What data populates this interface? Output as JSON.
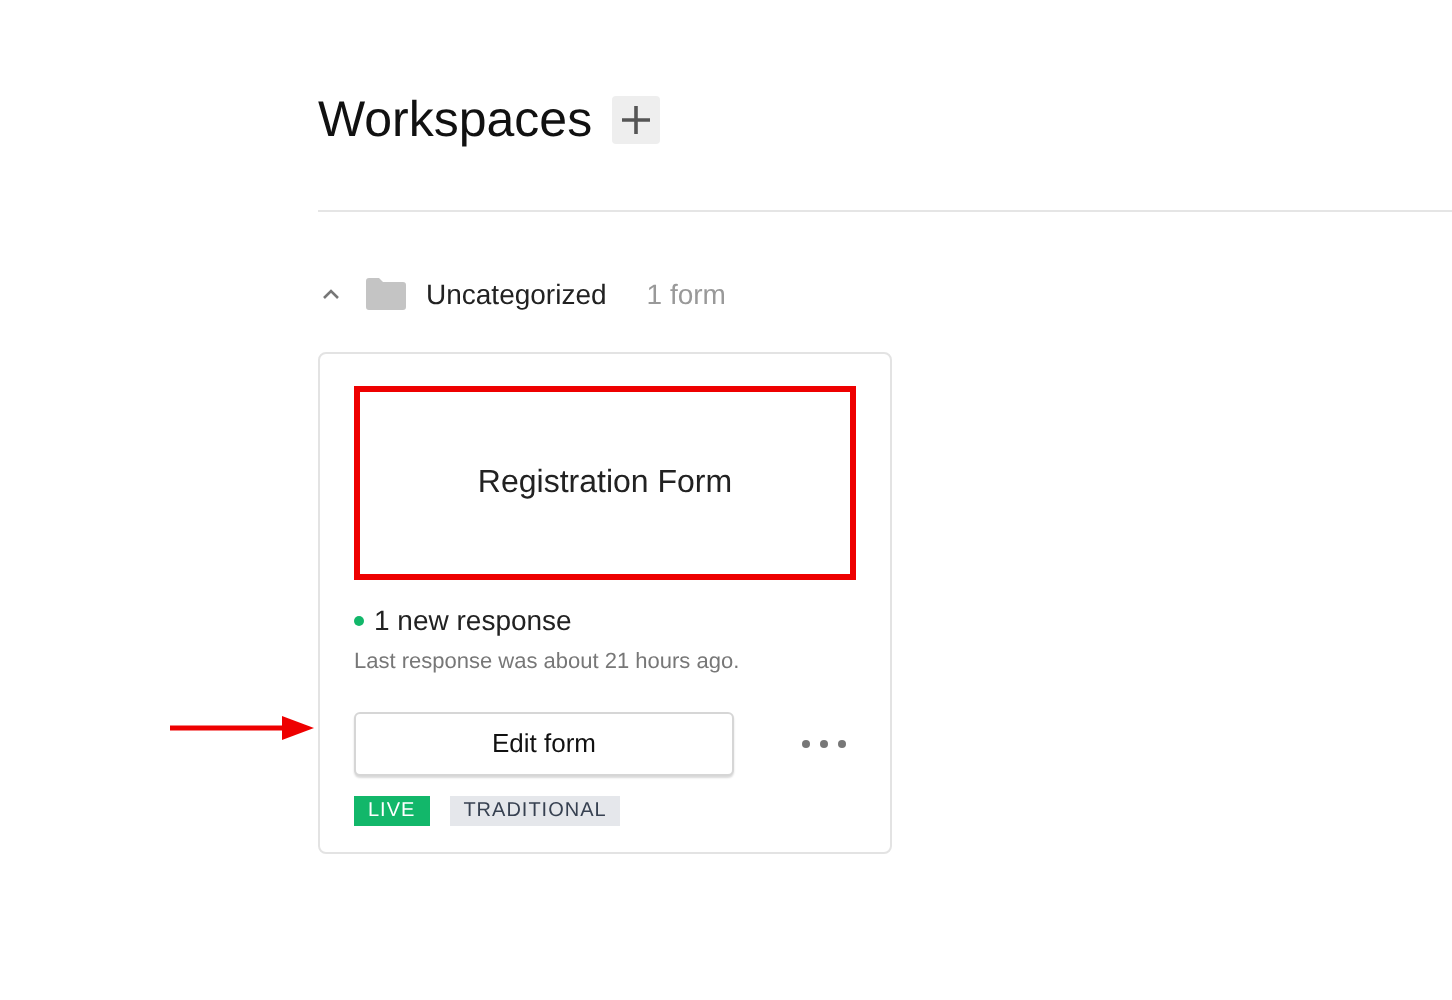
{
  "page": {
    "title": "Workspaces"
  },
  "workspaces": [
    {
      "name": "Uncategorized",
      "count": "1 form",
      "expanded": true,
      "forms": [
        {
          "title": "Registration Form",
          "highlighted": true,
          "responses": "1 new response",
          "last_response": "Last response was about 21 hours ago.",
          "edit_button": "Edit form",
          "pointed": true,
          "tags": [
            {
              "label": "LIVE",
              "color": "#12b76a"
            },
            {
              "label": "TRADITIONAL",
              "color": "#e5e7eb"
            }
          ]
        }
      ]
    }
  ]
}
